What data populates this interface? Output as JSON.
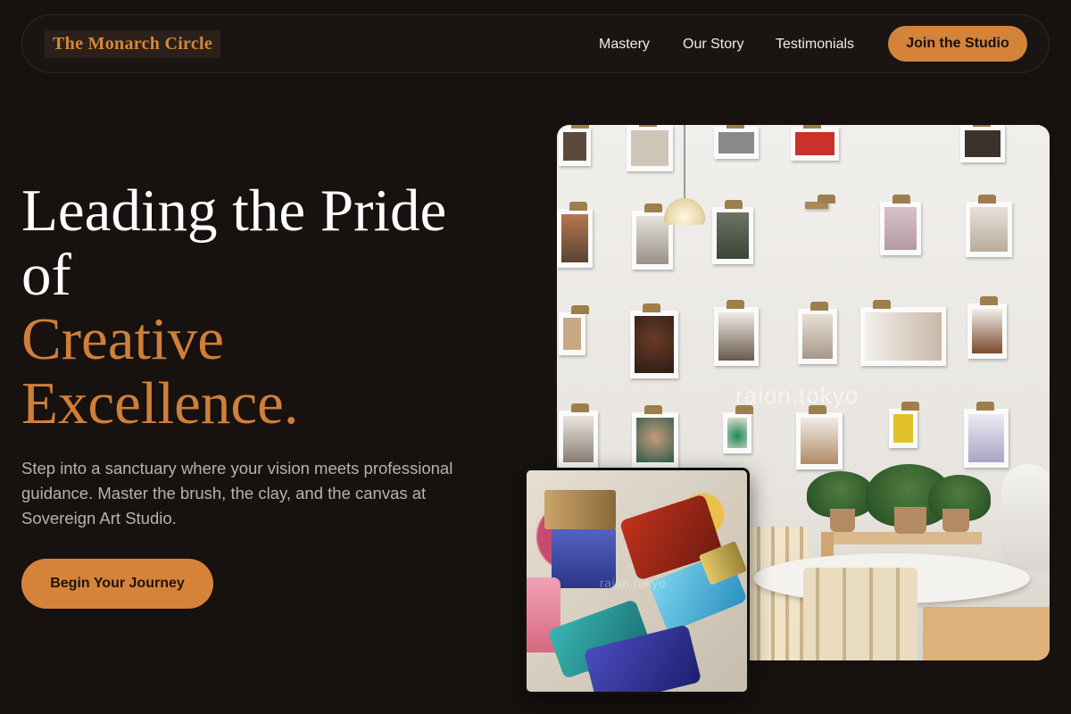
{
  "nav": {
    "logo": "The Monarch Circle",
    "links": [
      "Mastery",
      "Our Story",
      "Testimonials"
    ],
    "cta": "Join the Studio"
  },
  "hero": {
    "headline_line1": "Leading the Pride",
    "headline_line2": "of",
    "headline_accent_line1": "Creative",
    "headline_accent_line2": "Excellence.",
    "subtext": "Step into a sanctuary where your vision meets professional guidance. Master the brush, the clay, and the canvas at Sovereign Art Studio.",
    "cta": "Begin Your Journey"
  },
  "images": {
    "main_watermark": "raion.tokyo",
    "inset_watermark": "raion.tokyo"
  },
  "colors": {
    "background": "#17120f",
    "accent": "#d6833a",
    "logo_text": "#d48739",
    "headline": "#ffffff",
    "subtext": "#b9b2ac"
  }
}
